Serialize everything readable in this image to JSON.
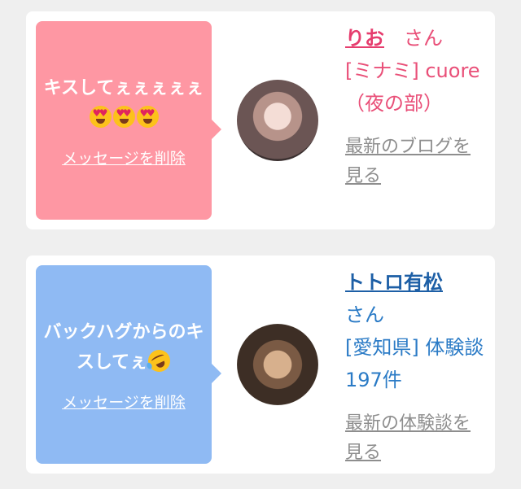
{
  "cards": [
    {
      "message": "キスしてぇぇぇぇぇ",
      "emoji": [
        "heart-eyes-emoji",
        "heart-eyes-emoji",
        "heart-eyes-emoji"
      ],
      "delete_label": "メッセージを削除",
      "name": "りお",
      "honorific": "さん",
      "shop": "[ミナミ] cuore（夜の部）",
      "link_label": "最新のブログを見る",
      "bubble_color": "#fe97a3"
    },
    {
      "message": "バックハグからのキスしてぇ",
      "emoji": [
        "rolling-laughing-emoji"
      ],
      "delete_label": "メッセージを削除",
      "name": "トトロ有松",
      "honorific": "さん",
      "shop": "[愛知県] 体験談 197件",
      "link_label": "最新の体験談を見る",
      "bubble_color": "#8fbaf3"
    }
  ]
}
